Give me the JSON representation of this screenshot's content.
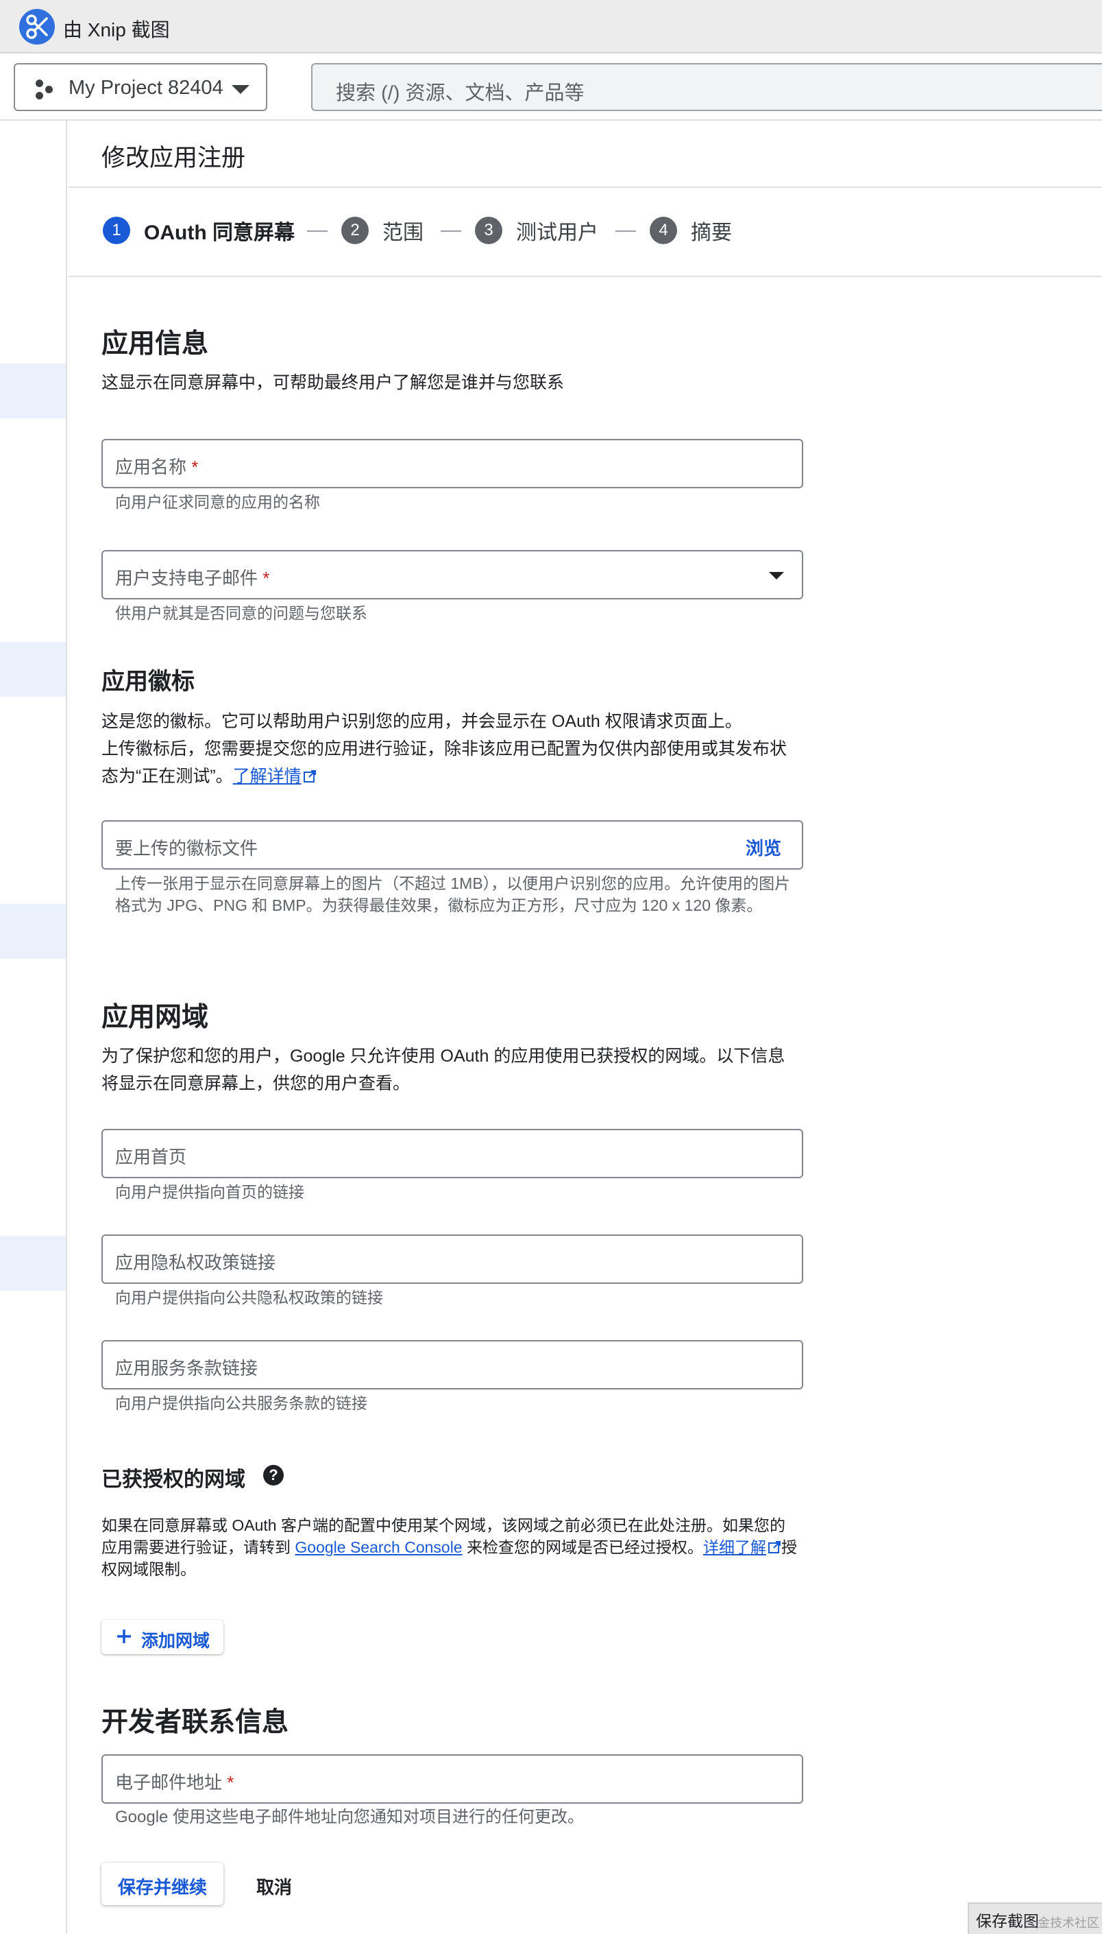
{
  "app": {
    "title": "由 Xnip 截图",
    "icon": "xnip-scissors-icon",
    "icon_color": "#2f6fde"
  },
  "header": {
    "project": "My Project 82404",
    "search_placeholder": "搜索 (/) 资源、文档、产品等"
  },
  "page": {
    "title": "修改应用注册"
  },
  "stepper": [
    {
      "num": "1",
      "label": "OAuth 同意屏幕",
      "active": true
    },
    {
      "num": "2",
      "label": "范围",
      "active": false
    },
    {
      "num": "3",
      "label": "测试用户",
      "active": false
    },
    {
      "num": "4",
      "label": "摘要",
      "active": false
    }
  ],
  "app_info": {
    "heading": "应用信息",
    "desc": "这显示在同意屏幕中，可帮助最终用户了解您是谁并与您联系",
    "app_name_label": "应用名称",
    "app_name_hint": "向用户征求同意的应用的名称",
    "support_email_label": "用户支持电子邮件",
    "support_email_hint": "供用户就其是否同意的问题与您联系",
    "required_mark": "*"
  },
  "logo": {
    "heading": "应用徽标",
    "desc_line1": "这是您的徽标。它可以帮助用户识别您的应用，并会显示在 OAuth 权限请求页面上。",
    "desc_line2": "上传徽标后，您需要提交您的应用进行验证，除非该应用已配置为仅供内部使用或其发布状态为“正在测试”。",
    "learn_more": "了解详情",
    "file_label": "要上传的徽标文件",
    "browse": "浏览",
    "file_hint": "上传一张用于显示在同意屏幕上的图片（不超过 1MB），以便用户识别您的应用。允许使用的图片格式为 JPG、PNG 和 BMP。为获得最佳效果，徽标应为正方形，尺寸应为 120 x 120 像素。"
  },
  "domain": {
    "heading": "应用网域",
    "desc": "为了保护您和您的用户，Google 只允许使用 OAuth 的应用使用已获授权的网域。以下信息将显示在同意屏幕上，供您的用户查看。",
    "homepage_label": "应用首页",
    "homepage_hint": "向用户提供指向首页的链接",
    "privacy_label": "应用隐私权政策链接",
    "privacy_hint": "向用户提供指向公共隐私权政策的链接",
    "tos_label": "应用服务条款链接",
    "tos_hint": "向用户提供指向公共服务条款的链接"
  },
  "authorized": {
    "heading": "已获授权的网域",
    "help": "?",
    "desc_part1": "如果在同意屏幕或 OAuth 客户端的配置中使用某个网域，该网域之前必须已在此处注册。如果您的应用需要进行验证，请转到",
    "console_link": "Google Search Console",
    "desc_part2": "来检查您的网域是否已经过授权。",
    "learn_more": "详细了解",
    "desc_part3": "授权网域限制。",
    "add_button": "添加网域"
  },
  "developer": {
    "heading": "开发者联系信息",
    "email_label": "电子邮件地址",
    "email_hint": "Google 使用这些电子邮件地址向您通知对项目进行的任何更改。"
  },
  "actions": {
    "save": "保存并继续",
    "cancel": "取消"
  },
  "snapshot_badge": {
    "title": "保存截图",
    "watermark": "金技术社区"
  }
}
